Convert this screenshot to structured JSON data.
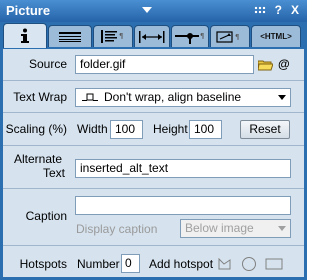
{
  "title": "Picture",
  "title_icons": {
    "dots": "grip-dots-icon",
    "help": "?",
    "close": "X"
  },
  "tabs": [
    {
      "icon": "info-icon"
    },
    {
      "icon": "border-lines-icon"
    },
    {
      "icon": "align-paragraph-icon"
    },
    {
      "icon": "spacing-icon"
    },
    {
      "icon": "position-icon"
    },
    {
      "icon": "link-icon"
    },
    {
      "label": "HTML"
    }
  ],
  "source": {
    "label": "Source",
    "value": "folder.gif",
    "at": "@"
  },
  "text_wrap": {
    "label": "Text Wrap",
    "value": "Don't wrap, align baseline"
  },
  "scaling": {
    "label": "Scaling (%)",
    "width_label": "Width",
    "width_value": "100",
    "height_label": "Height",
    "height_value": "100",
    "reset_label": "Reset"
  },
  "alternate_text": {
    "label_line1": "Alternate",
    "label_line2": "Text",
    "value": "inserted_alt_text"
  },
  "caption": {
    "label": "Caption",
    "value": "",
    "display_label": "Display caption",
    "display_value": "Below image"
  },
  "hotspots": {
    "label": "Hotspots",
    "number_label": "Number",
    "number_value": "0",
    "add_label": "Add hotspot"
  }
}
